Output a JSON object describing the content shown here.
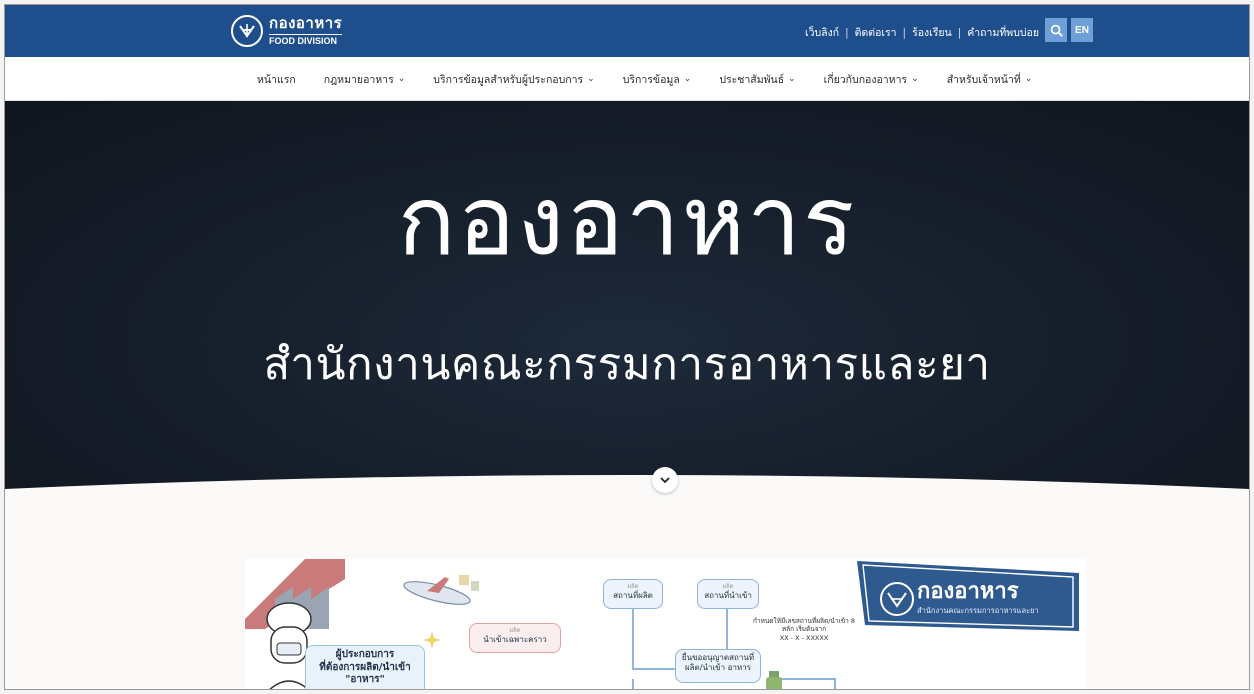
{
  "header": {
    "logo_th": "กองอาหาร",
    "logo_en": "FOOD DIVISION",
    "links": [
      "เว็บลิงก์",
      "ติดต่อเรา",
      "ร้องเรียน",
      "คำถามที่พบบ่อย"
    ],
    "search_icon": "search-icon",
    "lang_button": "EN"
  },
  "nav": {
    "items": [
      {
        "label": "หน้าแรก",
        "dropdown": false
      },
      {
        "label": "กฎหมายอาหาร",
        "dropdown": true
      },
      {
        "label": "บริการข้อมูลสำหรับผู้ประกอบการ",
        "dropdown": true
      },
      {
        "label": "บริการข้อมูล",
        "dropdown": true
      },
      {
        "label": "ประชาสัมพันธ์",
        "dropdown": true
      },
      {
        "label": "เกี่ยวกับกองอาหาร",
        "dropdown": true
      },
      {
        "label": "สำหรับเจ้าหน้าที่",
        "dropdown": true
      }
    ]
  },
  "hero": {
    "title": "กองอาหาร",
    "subtitle": "สำนักงานคณะกรรมการอาหารและยา"
  },
  "infographic": {
    "badge_title": "กองอาหาร",
    "badge_sub": "สำนักงานคณะกรรมการอาหารและยา",
    "operator_line1": "ผู้ประกอบการ",
    "operator_line2": "ที่ต้องการผลิต/นำเข้า",
    "operator_line3": "\"อาหาร\"",
    "node_tag": "ผลิต",
    "node_place_produce": "สถานที่ผลิต",
    "node_place_import": "สถานที่นำเข้า",
    "node_import_temp": "นำเข้าเฉพาะคราว",
    "node_license": "ยื่นขออนุญาตสถานที่ ผลิต/นำเข้า อาหาร",
    "node_note": "กำหนดให้มีเลขสถานที่ผลิต/นำเข้า 8 หลัก เริ่มต้นจาก",
    "node_code": "XX - X - XXXXX"
  },
  "colors": {
    "topbar": "#1f4e8c",
    "hero_bg": "#151d29",
    "accent_pink": "#c97a7a"
  }
}
